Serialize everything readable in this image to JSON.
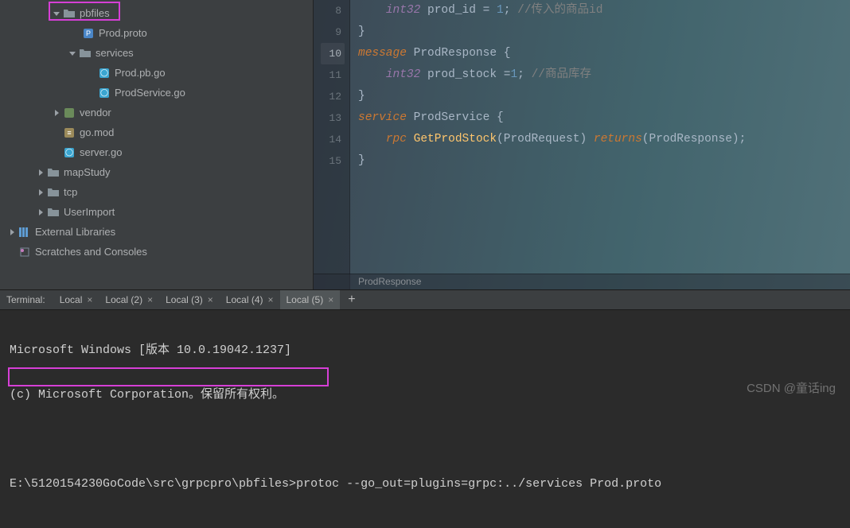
{
  "sidebar": {
    "pbfiles": "pbfiles",
    "prod_proto": "Prod.proto",
    "services": "services",
    "prod_pb_go": "Prod.pb.go",
    "prodservice_go": "ProdService.go",
    "vendor": "vendor",
    "go_mod": "go.mod",
    "server_go": "server.go",
    "mapstudy": "mapStudy",
    "tcp": "tcp",
    "userimport": "UserImport",
    "ext_lib": "External Libraries",
    "scratches": "Scratches and Consoles"
  },
  "code": {
    "l8_a": "int32",
    "l8_b": " prod_id = ",
    "l8_c": "1",
    "l8_d": "; ",
    "l8_e": "//传入的商品id",
    "l9": "}",
    "l10_a": "message",
    "l10_b": " ProdResponse {",
    "l11_a": "int32",
    "l11_b": " prod_stock =",
    "l11_c": "1",
    "l11_d": "; ",
    "l11_e": "//商品库存",
    "l12": "}",
    "l13_a": "service",
    "l13_b": " ProdService {",
    "l14_a": "rpc",
    "l14_b": " ",
    "l14_c": "GetProdStock",
    "l14_d": "(ProdRequest) ",
    "l14_e": "returns",
    "l14_f": "(ProdResponse);",
    "l15": "}",
    "ln8": "8",
    "ln9": "9",
    "ln10": "10",
    "ln11": "11",
    "ln12": "12",
    "ln13": "13",
    "ln14": "14",
    "ln15": "15"
  },
  "breadcrumb": "ProdResponse",
  "terminal": {
    "label": "Terminal:",
    "tabs": [
      "Local",
      "Local (2)",
      "Local (3)",
      "Local (4)",
      "Local (5)"
    ],
    "line1": "Microsoft Windows [版本 10.0.19042.1237]",
    "line2": "(c) Microsoft Corporation。保留所有权利。",
    "prompt": "E:\\5120154230GoCode\\src\\grpcpro\\pbfiles>",
    "cmd": "protoc --go_out=plugins=grpc:../services Prod.proto"
  },
  "watermark": "CSDN @童话ing"
}
